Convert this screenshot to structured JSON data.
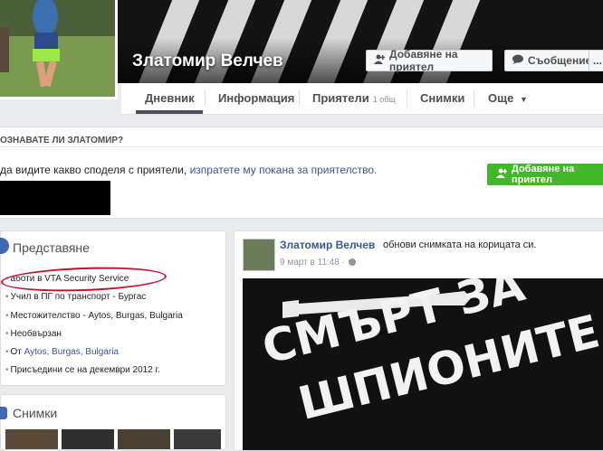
{
  "profile": {
    "name": "Златомир Велчев",
    "add_friend_label": "Добавяне на приятел",
    "message_label": "Съобщение",
    "more_label": "..."
  },
  "tabs": [
    {
      "label": "Дневник",
      "active": true
    },
    {
      "label": "Информация"
    },
    {
      "label": "Приятели",
      "count": "1 общ"
    },
    {
      "label": "Снимки"
    },
    {
      "label": "Още",
      "dropdown": true
    }
  ],
  "know_box": {
    "title": "ОЗНАВАТЕ ЛИ ЗЛАТОМИР?",
    "text_before": "да видите какво споделя с приятели,",
    "link_text": "изпратете му покана за приятелство.",
    "button_label": "Добавяне на приятел"
  },
  "intro": {
    "title": "Представяне",
    "items": [
      {
        "text": "аботи в VTA Security Service"
      },
      {
        "text": "Учил в ПГ по транспорт - Бургас"
      },
      {
        "text": "Местожителство - Aytos, Burgas, Bulgaria"
      },
      {
        "text": "Необвързан"
      },
      {
        "prefix": "От ",
        "link": "Aytos, Burgas, Bulgaria"
      },
      {
        "text": "Присъедини се на декември 2012 г."
      }
    ]
  },
  "photos": {
    "title": "Снимки"
  },
  "post": {
    "author": "Златомир Велчев",
    "action": "обнови снимката на корицата си.",
    "time": "9 март в 11:48 ·",
    "image_text_line1": "СМЪРТ ЗА",
    "image_text_line2": "ШПИОНИТЕ"
  },
  "colors": {
    "brand_blue": "#4267b2",
    "link": "#365899",
    "green": "#42b72a",
    "highlight_red": "#c8102e"
  },
  "icons": {
    "add_friend": "add-person-icon",
    "message": "chat-bubble-icon",
    "privacy": "globe-icon"
  }
}
